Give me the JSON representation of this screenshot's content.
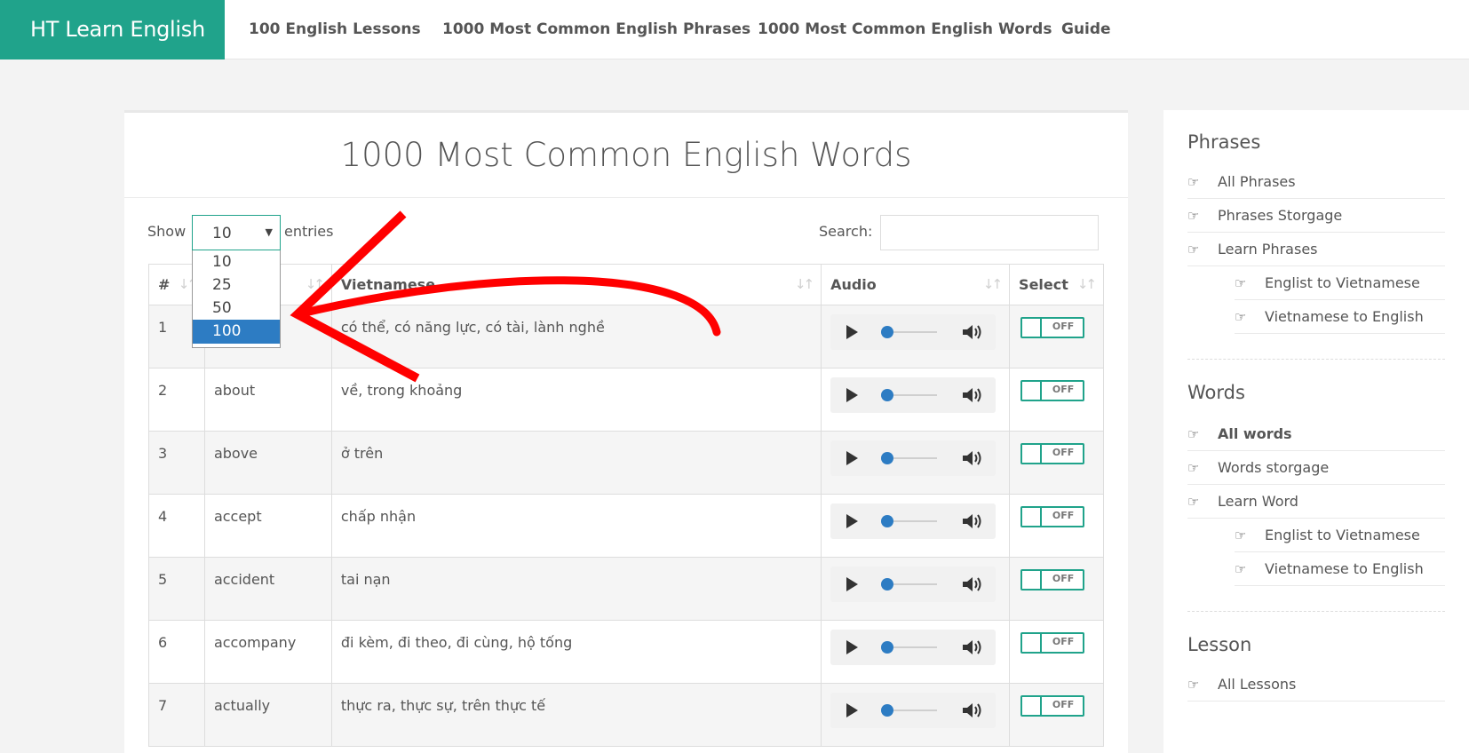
{
  "nav": {
    "brand": "HT Learn English",
    "links": [
      "100 English Lessons",
      "1000 Most Common English Phrases",
      "1000 Most Common English Words",
      "Guide"
    ]
  },
  "main": {
    "title": "1000 Most Common English Words",
    "show_label": "Show",
    "entries_label": "entries",
    "page_size_selected": "10",
    "page_size_options": [
      "10",
      "25",
      "50",
      "100"
    ],
    "search_label": "Search:",
    "search_value": "",
    "columns": [
      "#",
      "",
      "Vietnamese",
      "Audio",
      "Select"
    ],
    "rows": [
      {
        "num": "1",
        "word": "",
        "vi": "có thể, có năng lực, có tài, lành nghề",
        "toggle": "OFF"
      },
      {
        "num": "2",
        "word": "about",
        "vi": "về, trong khoảng",
        "toggle": "OFF"
      },
      {
        "num": "3",
        "word": "above",
        "vi": "ở trên",
        "toggle": "OFF"
      },
      {
        "num": "4",
        "word": "accept",
        "vi": "chấp nhận",
        "toggle": "OFF"
      },
      {
        "num": "5",
        "word": "accident",
        "vi": "tai nạn",
        "toggle": "OFF"
      },
      {
        "num": "6",
        "word": "accompany",
        "vi": "đi kèm, đi theo, đi cùng, hộ tống",
        "toggle": "OFF"
      },
      {
        "num": "7",
        "word": "actually",
        "vi": "thực ra, thực sự, trên thực tế",
        "toggle": "OFF"
      }
    ]
  },
  "sidebar": {
    "phrases_heading": "Phrases",
    "phrases_items": [
      "All Phrases",
      "Phrases Storgage",
      "Learn Phrases"
    ],
    "phrases_sub": [
      "Englist to Vietnamese",
      "Vietnamese to English"
    ],
    "words_heading": "Words",
    "words_items": [
      "All words",
      "Words storgage",
      "Learn Word"
    ],
    "words_sub": [
      "Englist to Vietnamese",
      "Vietnamese to English"
    ],
    "lesson_heading": "Lesson",
    "lesson_items": [
      "All Lessons"
    ]
  },
  "colors": {
    "brand": "#20a38b",
    "selected_option": "#2d7cc3",
    "annotation_arrow": "#ff0000"
  }
}
